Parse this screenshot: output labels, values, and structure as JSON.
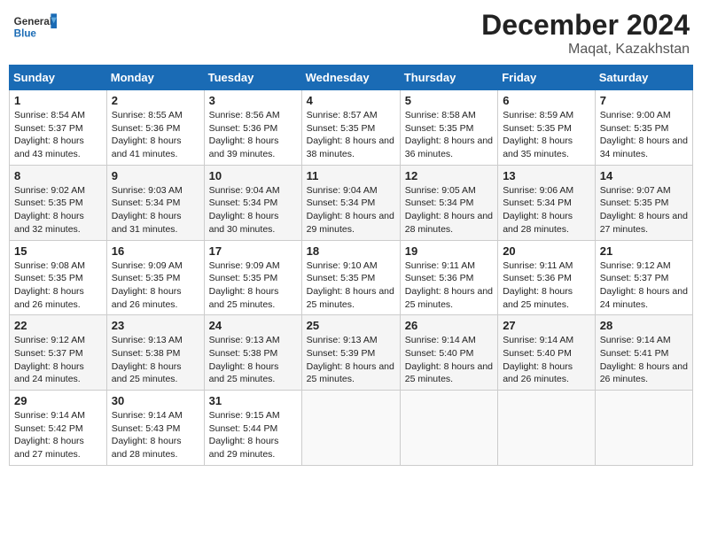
{
  "header": {
    "logo_text_general": "General",
    "logo_text_blue": "Blue",
    "title": "December 2024",
    "subtitle": "Maqat, Kazakhstan"
  },
  "weekdays": [
    "Sunday",
    "Monday",
    "Tuesday",
    "Wednesday",
    "Thursday",
    "Friday",
    "Saturday"
  ],
  "weeks": [
    [
      {
        "day": "1",
        "sunrise": "8:54 AM",
        "sunset": "5:37 PM",
        "daylight": "8 hours and 43 minutes."
      },
      {
        "day": "2",
        "sunrise": "8:55 AM",
        "sunset": "5:36 PM",
        "daylight": "8 hours and 41 minutes."
      },
      {
        "day": "3",
        "sunrise": "8:56 AM",
        "sunset": "5:36 PM",
        "daylight": "8 hours and 39 minutes."
      },
      {
        "day": "4",
        "sunrise": "8:57 AM",
        "sunset": "5:35 PM",
        "daylight": "8 hours and 38 minutes."
      },
      {
        "day": "5",
        "sunrise": "8:58 AM",
        "sunset": "5:35 PM",
        "daylight": "8 hours and 36 minutes."
      },
      {
        "day": "6",
        "sunrise": "8:59 AM",
        "sunset": "5:35 PM",
        "daylight": "8 hours and 35 minutes."
      },
      {
        "day": "7",
        "sunrise": "9:00 AM",
        "sunset": "5:35 PM",
        "daylight": "8 hours and 34 minutes."
      }
    ],
    [
      {
        "day": "8",
        "sunrise": "9:02 AM",
        "sunset": "5:35 PM",
        "daylight": "8 hours and 32 minutes."
      },
      {
        "day": "9",
        "sunrise": "9:03 AM",
        "sunset": "5:34 PM",
        "daylight": "8 hours and 31 minutes."
      },
      {
        "day": "10",
        "sunrise": "9:04 AM",
        "sunset": "5:34 PM",
        "daylight": "8 hours and 30 minutes."
      },
      {
        "day": "11",
        "sunrise": "9:04 AM",
        "sunset": "5:34 PM",
        "daylight": "8 hours and 29 minutes."
      },
      {
        "day": "12",
        "sunrise": "9:05 AM",
        "sunset": "5:34 PM",
        "daylight": "8 hours and 28 minutes."
      },
      {
        "day": "13",
        "sunrise": "9:06 AM",
        "sunset": "5:34 PM",
        "daylight": "8 hours and 28 minutes."
      },
      {
        "day": "14",
        "sunrise": "9:07 AM",
        "sunset": "5:35 PM",
        "daylight": "8 hours and 27 minutes."
      }
    ],
    [
      {
        "day": "15",
        "sunrise": "9:08 AM",
        "sunset": "5:35 PM",
        "daylight": "8 hours and 26 minutes."
      },
      {
        "day": "16",
        "sunrise": "9:09 AM",
        "sunset": "5:35 PM",
        "daylight": "8 hours and 26 minutes."
      },
      {
        "day": "17",
        "sunrise": "9:09 AM",
        "sunset": "5:35 PM",
        "daylight": "8 hours and 25 minutes."
      },
      {
        "day": "18",
        "sunrise": "9:10 AM",
        "sunset": "5:35 PM",
        "daylight": "8 hours and 25 minutes."
      },
      {
        "day": "19",
        "sunrise": "9:11 AM",
        "sunset": "5:36 PM",
        "daylight": "8 hours and 25 minutes."
      },
      {
        "day": "20",
        "sunrise": "9:11 AM",
        "sunset": "5:36 PM",
        "daylight": "8 hours and 25 minutes."
      },
      {
        "day": "21",
        "sunrise": "9:12 AM",
        "sunset": "5:37 PM",
        "daylight": "8 hours and 24 minutes."
      }
    ],
    [
      {
        "day": "22",
        "sunrise": "9:12 AM",
        "sunset": "5:37 PM",
        "daylight": "8 hours and 24 minutes."
      },
      {
        "day": "23",
        "sunrise": "9:13 AM",
        "sunset": "5:38 PM",
        "daylight": "8 hours and 25 minutes."
      },
      {
        "day": "24",
        "sunrise": "9:13 AM",
        "sunset": "5:38 PM",
        "daylight": "8 hours and 25 minutes."
      },
      {
        "day": "25",
        "sunrise": "9:13 AM",
        "sunset": "5:39 PM",
        "daylight": "8 hours and 25 minutes."
      },
      {
        "day": "26",
        "sunrise": "9:14 AM",
        "sunset": "5:40 PM",
        "daylight": "8 hours and 25 minutes."
      },
      {
        "day": "27",
        "sunrise": "9:14 AM",
        "sunset": "5:40 PM",
        "daylight": "8 hours and 26 minutes."
      },
      {
        "day": "28",
        "sunrise": "9:14 AM",
        "sunset": "5:41 PM",
        "daylight": "8 hours and 26 minutes."
      }
    ],
    [
      {
        "day": "29",
        "sunrise": "9:14 AM",
        "sunset": "5:42 PM",
        "daylight": "8 hours and 27 minutes."
      },
      {
        "day": "30",
        "sunrise": "9:14 AM",
        "sunset": "5:43 PM",
        "daylight": "8 hours and 28 minutes."
      },
      {
        "day": "31",
        "sunrise": "9:15 AM",
        "sunset": "5:44 PM",
        "daylight": "8 hours and 29 minutes."
      },
      null,
      null,
      null,
      null
    ]
  ]
}
